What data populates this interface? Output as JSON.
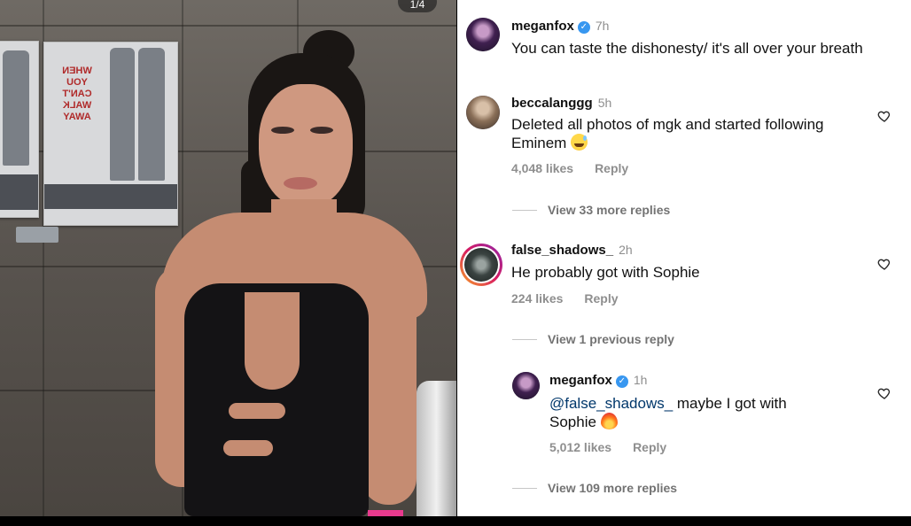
{
  "photo": {
    "slide_counter": "1/4",
    "poster_text": "WHEN YOU CAN'T WALK AWAY"
  },
  "caption": {
    "username": "meganfox",
    "verified": true,
    "time": "7h",
    "text": "You can taste the dishonesty/ it's all over your breath"
  },
  "comments": [
    {
      "username": "beccalanggg",
      "time": "5h",
      "text": "Deleted all photos of mgk and started following Eminem",
      "emoji": "😅",
      "likes": "4,048 likes",
      "reply_label": "Reply",
      "view_replies": "View 33 more replies"
    },
    {
      "username": "false_shadows_",
      "time": "2h",
      "text": "He probably got with Sophie",
      "likes": "224 likes",
      "reply_label": "Reply",
      "view_previous": "View 1 previous reply",
      "reply": {
        "username": "meganfox",
        "verified": true,
        "time": "1h",
        "mention": "@false_shadows_",
        "text_line1": " maybe I got with",
        "text_line2": "Sophie",
        "emoji": "🔥",
        "likes": "5,012 likes",
        "reply_label": "Reply"
      },
      "view_more": "View 109 more replies"
    }
  ],
  "colors": {
    "verified_blue": "#3897f0",
    "mention_blue": "#00376b",
    "muted_gray": "#8e8e8e"
  }
}
